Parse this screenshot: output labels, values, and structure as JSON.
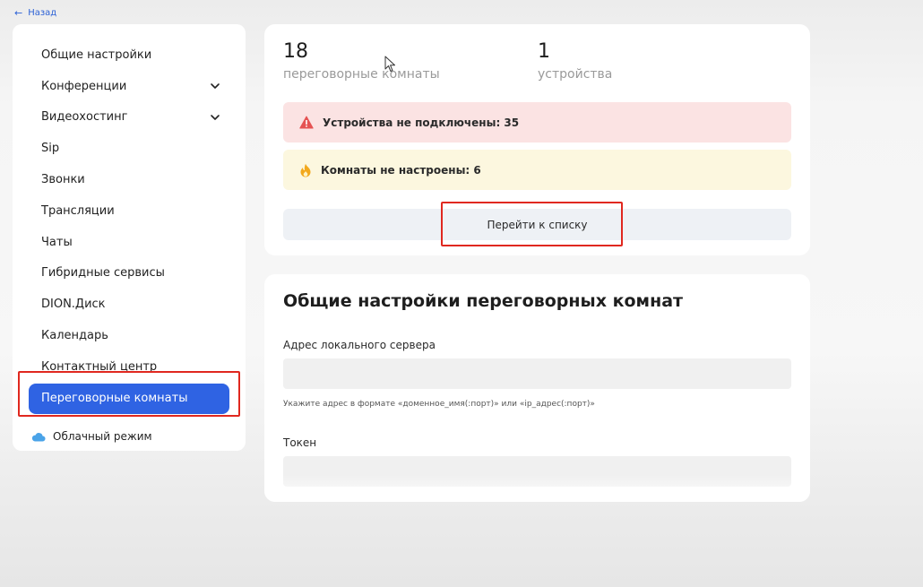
{
  "header": {
    "back_label": "Назад"
  },
  "sidebar": {
    "items": [
      {
        "label": "Общие настройки",
        "expandable": false
      },
      {
        "label": "Конференции",
        "expandable": true
      },
      {
        "label": "Видеохостинг",
        "expandable": true
      },
      {
        "label": "Sip",
        "expandable": false
      },
      {
        "label": "Звонки",
        "expandable": false
      },
      {
        "label": "Трансляции",
        "expandable": false
      },
      {
        "label": "Чаты",
        "expandable": false
      },
      {
        "label": "Гибридные сервисы",
        "expandable": false
      },
      {
        "label": "DION.Диск",
        "expandable": false
      },
      {
        "label": "Календарь",
        "expandable": false
      },
      {
        "label": "Контактный центр",
        "expandable": false
      },
      {
        "label": "Переговорные комнаты",
        "expandable": false,
        "active": true
      }
    ],
    "cloud_mode_label": "Облачный режим",
    "cloud_icon": "cloud-icon"
  },
  "summary": {
    "rooms_count": "18",
    "rooms_label": "переговорные комнаты",
    "devices_count": "1",
    "devices_label": "устройства",
    "alert_devices": {
      "text": "Устройства не подключены: 35",
      "icon": "warning-triangle-icon",
      "color": "#e55353"
    },
    "alert_rooms": {
      "text": "Комнаты не настроены: 6",
      "icon": "fire-icon",
      "color": "#f2a81d"
    },
    "go_to_list_label": "Перейти к списку"
  },
  "settings": {
    "title": "Общие настройки переговорных комнат",
    "server_label": "Адрес локального сервера",
    "server_value": "",
    "server_hint": "Укажите адрес в формате «доменное_имя(:порт)» или «ip_адрес(:порт)»",
    "token_label": "Токен",
    "token_value": ""
  },
  "colors": {
    "accent": "#2f63e3",
    "highlight": "#e0281f"
  }
}
